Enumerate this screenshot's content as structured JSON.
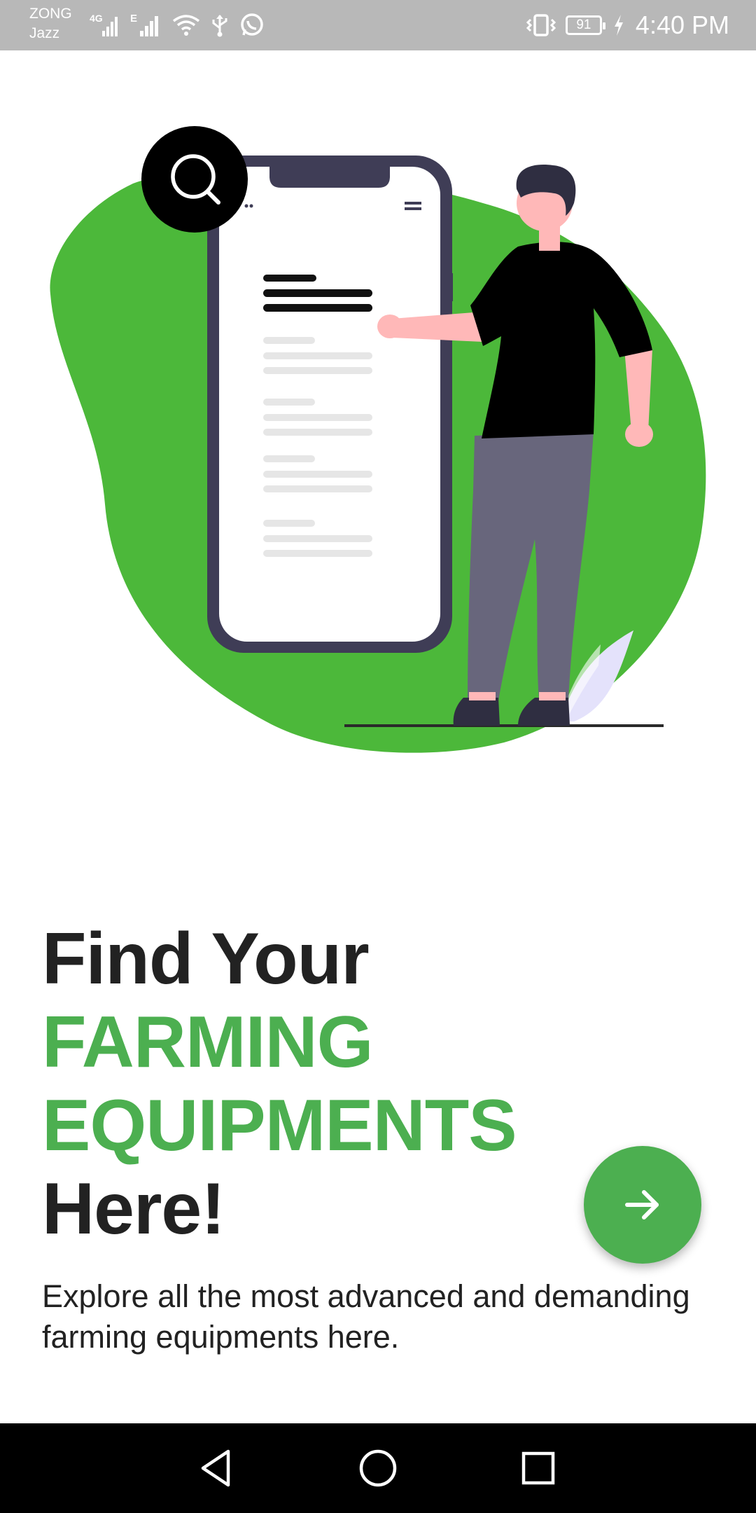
{
  "status_bar": {
    "carrier_primary": "ZONG",
    "carrier_secondary": "Jazz",
    "network_primary": "4G",
    "network_secondary": "E",
    "icons": [
      "signal-icon",
      "signal-icon",
      "wifi-icon",
      "usb-icon",
      "whatsapp-icon",
      "vibrate-icon",
      "battery-icon",
      "charging-icon"
    ],
    "battery_level": "91",
    "time": "4:40 PM"
  },
  "illustration": {
    "name": "phone-search-illustration",
    "accent_color": "#4cb83a"
  },
  "headline": {
    "line1": "Find Your",
    "line2": "FARMING",
    "line3": "EQUIPMENTS",
    "line4": "Here!"
  },
  "subtitle": "Explore all the most advanced and demanding farming equipments here.",
  "fab": {
    "icon": "arrow-right-icon",
    "color": "#4caf50"
  },
  "nav_bar": {
    "buttons": [
      "back-icon",
      "home-icon",
      "recents-icon"
    ]
  },
  "colors": {
    "brand_green": "#4caf50",
    "text_dark": "#222222"
  }
}
